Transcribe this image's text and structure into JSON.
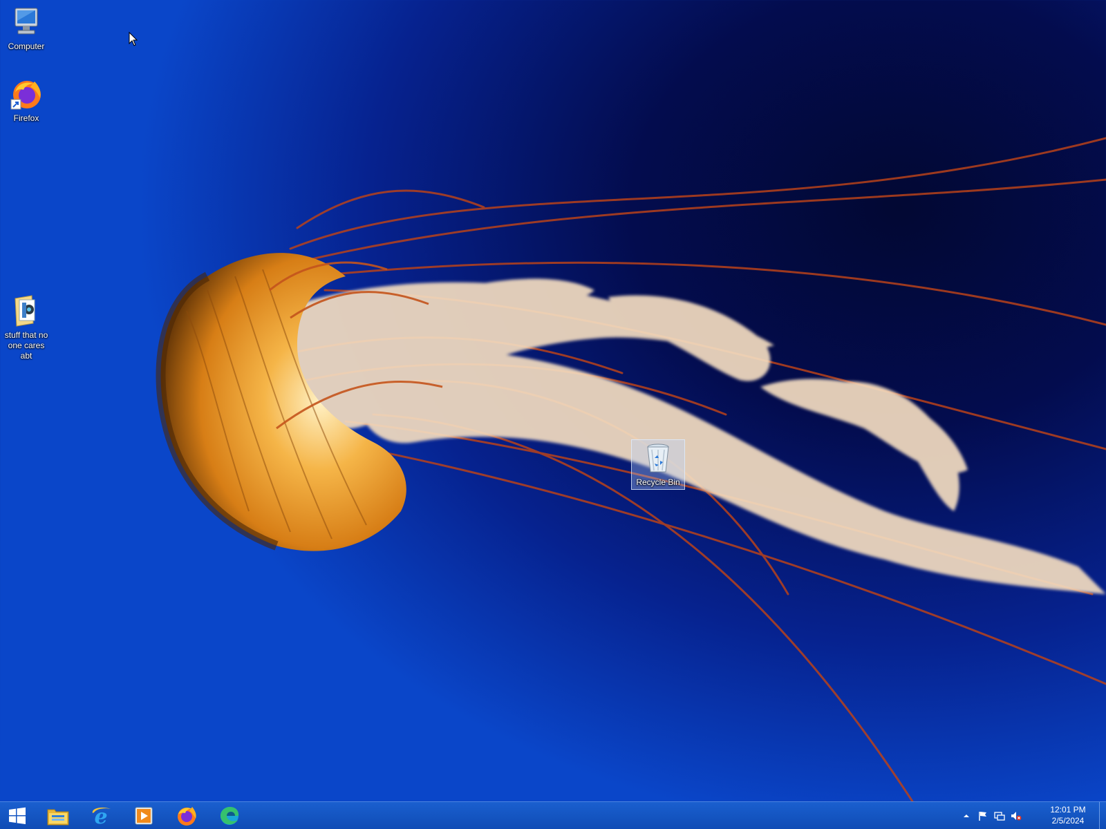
{
  "desktop": {
    "icons": [
      {
        "label": "Computer",
        "icon": "computer-icon"
      },
      {
        "label": "Firefox",
        "icon": "firefox-icon"
      },
      {
        "label": "stuff that no one cares abt",
        "icon": "folder-icon"
      },
      {
        "label": "Recycle Bin",
        "icon": "recycle-bin-icon"
      }
    ]
  },
  "taskbar": {
    "start": {
      "icon": "windows-logo-icon"
    },
    "pinned": [
      {
        "name": "File Explorer",
        "icon": "file-explorer-icon"
      },
      {
        "name": "Internet Explorer",
        "icon": "internet-explorer-icon"
      },
      {
        "name": "Windows Media Player",
        "icon": "media-player-icon"
      },
      {
        "name": "Firefox",
        "icon": "firefox-icon"
      },
      {
        "name": "Microsoft Edge",
        "icon": "edge-icon"
      }
    ],
    "tray": {
      "icons": [
        "show-hidden-icons-chevron",
        "action-center-flag-icon",
        "network-icon",
        "volume-muted-icon"
      ],
      "time": "12:01 PM",
      "date": "2/5/2024"
    }
  },
  "colors": {
    "taskbar": "#1356c4",
    "wallpaper_deep": "#030c4e",
    "wallpaper_light": "#0a46c9",
    "jelly_bell": "#e08a1e",
    "tentacle": "#c2451c"
  }
}
